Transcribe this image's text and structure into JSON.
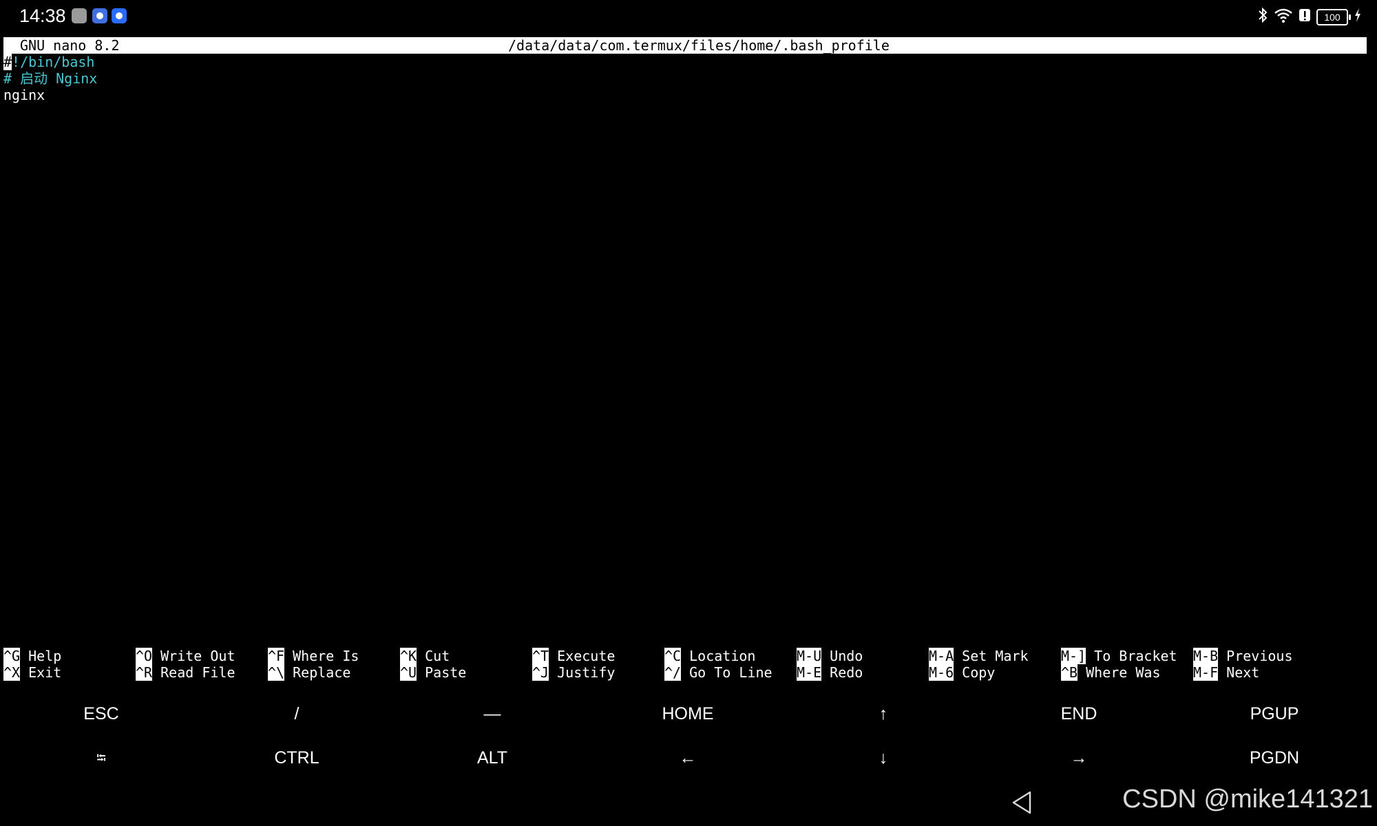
{
  "status_bar": {
    "time": "14:38",
    "battery": "100",
    "icons": [
      "bluetooth-icon",
      "wifi-icon",
      "alert-icon",
      "battery-icon",
      "charging-icon"
    ]
  },
  "nano": {
    "version": "GNU nano 8.2",
    "path": "/data/data/com.termux/files/home/.bash_profile"
  },
  "editor": {
    "line1_cursor": "#",
    "line1_rest": "!/bin/bash",
    "line2": "# 启动 Nginx",
    "line3": "nginx"
  },
  "shortcuts": [
    {
      "k1": "^G",
      "l1": "Help",
      "k2": "^X",
      "l2": "Exit"
    },
    {
      "k1": "^O",
      "l1": "Write Out",
      "k2": "^R",
      "l2": "Read File"
    },
    {
      "k1": "^F",
      "l1": "Where Is",
      "k2": "^\\",
      "l2": "Replace"
    },
    {
      "k1": "^K",
      "l1": "Cut",
      "k2": "^U",
      "l2": "Paste"
    },
    {
      "k1": "^T",
      "l1": "Execute",
      "k2": "^J",
      "l2": "Justify"
    },
    {
      "k1": "^C",
      "l1": "Location",
      "k2": "^/",
      "l2": "Go To Line"
    },
    {
      "k1": "M-U",
      "l1": "Undo",
      "k2": "M-E",
      "l2": "Redo"
    },
    {
      "k1": "M-A",
      "l1": "Set Mark",
      "k2": "M-6",
      "l2": "Copy"
    },
    {
      "k1": "M-]",
      "l1": "To Bracket",
      "k2": "^B",
      "l2": "Where Was"
    },
    {
      "k1": "M-B",
      "l1": "Previous",
      "k2": "M-F",
      "l2": "Next"
    }
  ],
  "extra_keys": {
    "row1": [
      "ESC",
      "/",
      "—",
      "HOME",
      "↑",
      "END",
      "PGUP"
    ],
    "row2": [
      "⭾",
      "CTRL",
      "ALT",
      "←",
      "↓",
      "→",
      "PGDN"
    ]
  },
  "watermark": "CSDN @mike141321",
  "colors": {
    "comment": "#49c5cf",
    "background": "#000000",
    "foreground": "#ffffff"
  }
}
